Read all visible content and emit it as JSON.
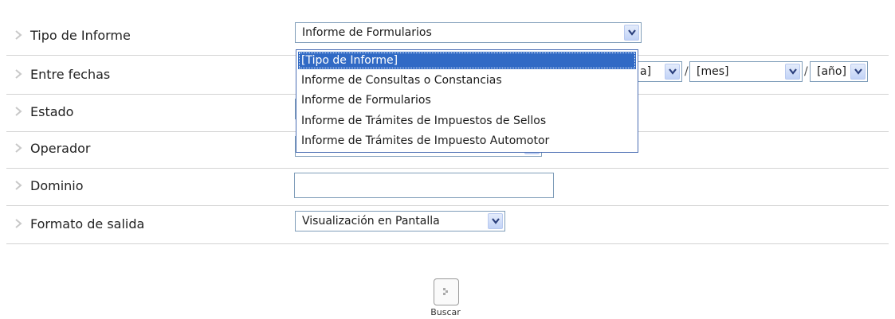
{
  "form": {
    "rows": [
      {
        "label": "Tipo de Informe"
      },
      {
        "label": "Entre fechas"
      },
      {
        "label": "Estado"
      },
      {
        "label": "Operador"
      },
      {
        "label": "Dominio"
      },
      {
        "label": "Formato de salida"
      }
    ],
    "tipo_informe": {
      "selected": "Informe de Formularios",
      "options": [
        "[Tipo de Informe]",
        "Informe de Consultas o Constancias",
        "Informe de Formularios",
        "Informe de Trámites de Impuestos de Sellos",
        "Informe de Trámites de Impuesto Automotor"
      ],
      "highlighted_index": 0
    },
    "fechas": {
      "dia_partial": "a]",
      "mes": "[mes]",
      "anio": "[año]",
      "separator": "/"
    },
    "dominio": {
      "value": ""
    },
    "formato_salida": {
      "selected": "Visualización en Pantalla"
    },
    "buscar": {
      "label": "Buscar"
    }
  },
  "colors": {
    "border": "#7f9db9",
    "highlight": "#316ac5",
    "row_divider": "#d3d3d3"
  },
  "icons": {
    "row_bullet": "chevron-right-icon",
    "dropdown_arrow": "chevron-down-icon",
    "search_button": "chevron-right-icon"
  }
}
